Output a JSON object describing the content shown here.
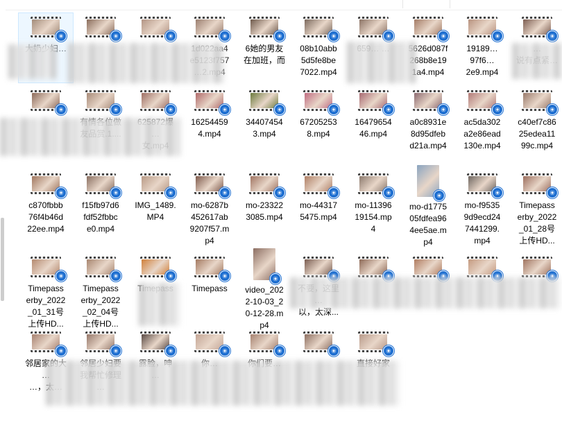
{
  "window": {
    "title": ""
  },
  "colors": {
    "play_badge": "#1e6fd1",
    "selection": "#cce8ff"
  },
  "badge_icon": "play-badge-icon",
  "rows": [
    [
      {
        "name": "大奶少妇…",
        "tint": "#a38c7a"
      },
      {
        "name": "",
        "tint": "#8a6d5c"
      },
      {
        "name": "",
        "tint": "#b39585"
      },
      {
        "name": "1d022aa4\ne5123f757\n…2.mp4",
        "tint": "#9b7f70"
      },
      {
        "name": "6她的男友\n在加班，而",
        "tint": "#6f5a4c"
      },
      {
        "name": "08b10abb\n5d5fe8be\n7022.mp4",
        "tint": "#7c6a5e"
      },
      {
        "name": "659… …",
        "tint": "#8c7466"
      },
      {
        "name": "5626d087f\n268b8e19\n1a4.mp4",
        "tint": "#a47c66"
      },
      {
        "name": "19189…\n97f6…\n2e9.mp4",
        "tint": "#b8927f"
      },
      {
        "name": "…\n说有点紧…",
        "tint": "#7d5e52"
      }
    ],
    [
      {
        "name": "",
        "tint": "#8c6a5a"
      },
      {
        "name": "有情各位做\n友品赏.1....",
        "tint": "#a78a78"
      },
      {
        "name": "625872爆\n…\n女.mp4",
        "tint": "#9e6f64"
      },
      {
        "name": "16254459\n4.mp4",
        "tint": "#b06a6a"
      },
      {
        "name": "34407454\n3.mp4",
        "tint": "#6c7a3e"
      },
      {
        "name": "67205253\n8.mp4",
        "tint": "#c06d82"
      },
      {
        "name": "16479654\n46.mp4",
        "tint": "#a86a72"
      },
      {
        "name": "a0c8931e\n8d95dfeb\nd21a.mp4",
        "tint": "#8c6a70"
      },
      {
        "name": "ac5da302\na2e86ead\n130e.mp4",
        "tint": "#b27b78"
      },
      {
        "name": "c40ef7c86\n25edea11\n99c.mp4",
        "tint": "#9a7b6c"
      }
    ],
    [
      {
        "name": "c870fbbb\n76f4b46d\n22ee.mp4",
        "tint": "#a0765e"
      },
      {
        "name": "f15fb97d6\nfdf52fbbc\ne0.mp4",
        "tint": "#8a7062"
      },
      {
        "name": "IMG_1489.\nMP4",
        "tint": "#b89a86"
      },
      {
        "name": "mo-6287b\n452617ab\n9207f57.m\np4",
        "tint": "#7e5a4c"
      },
      {
        "name": "mo-23322\n3085.mp4",
        "tint": "#a07462"
      },
      {
        "name": "mo-44317\n5475.mp4",
        "tint": "#b08066"
      },
      {
        "name": "mo-11396\n19154.mp\n4",
        "tint": "#8c7a6e"
      },
      {
        "name": "mo-d1775\n05fdfea96\n4ee5ae.m\np4",
        "tint": "#8aa4c0",
        "portrait": true
      },
      {
        "name": "mo-f9535\n9d9ecd24\n7441299.\nmp4",
        "tint": "#6e6660"
      },
      {
        "name": "Timepass\nerby_2022\n_01_28号\n上传HD...",
        "tint": "#9c6e5e"
      }
    ],
    [
      {
        "name": "Timepass\nerby_2022\n_01_31号\n上传HD...",
        "tint": "#b58a70"
      },
      {
        "name": "Timepass\nerby_2022\n_02_04号\n上传HD...",
        "tint": "#a88670"
      },
      {
        "name": "Timepass",
        "tint": "#d0803a"
      },
      {
        "name": "Timepass",
        "tint": "#a47a62"
      },
      {
        "name": "video_202\n2-10-03_2\n0-12-28.m\np4",
        "tint": "#8c6e62",
        "portrait": true
      },
      {
        "name": "不要，这里\n…\n以，太深...",
        "tint": "#7a5e52"
      },
      {
        "name": "",
        "tint": "#8e6a58"
      },
      {
        "name": "",
        "tint": "#b07c60"
      },
      {
        "name": "",
        "tint": "#c49a80"
      },
      {
        "name": "",
        "tint": "#a07460"
      }
    ],
    [
      {
        "name": "邻居家的大\n…\n…，太…",
        "tint": "#a88270"
      },
      {
        "name": "邻居少妇要\n我帮忙修理\n…",
        "tint": "#96786a"
      },
      {
        "name": "露脸，呻\n…",
        "tint": "#5a4a44"
      },
      {
        "name": "你…",
        "tint": "#c4a696"
      },
      {
        "name": "你们要…",
        "tint": "#a68270"
      },
      {
        "name": "",
        "tint": "#8e7062"
      },
      {
        "name": "直接好家",
        "tint": "#b89a8a"
      }
    ]
  ]
}
